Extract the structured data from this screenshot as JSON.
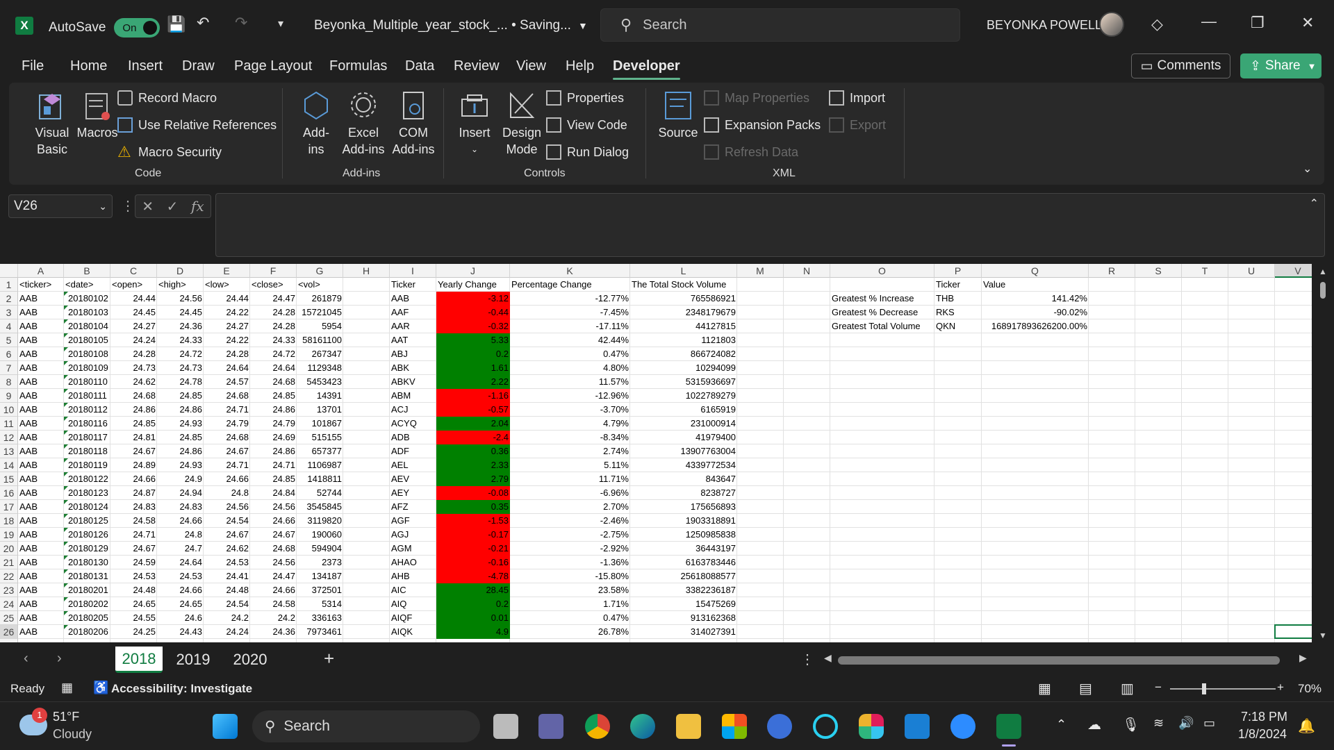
{
  "titlebar": {
    "app_icon": "X",
    "autosave_label": "AutoSave",
    "autosave_state": "On",
    "doc_title": "Beyonka_Multiple_year_stock_...  • Saving...",
    "search_placeholder": "Search",
    "user_name": "BEYONKA POWELL"
  },
  "menu": {
    "items": [
      "File",
      "Home",
      "Insert",
      "Draw",
      "Page Layout",
      "Formulas",
      "Data",
      "Review",
      "View",
      "Help",
      "Developer"
    ],
    "active": "Developer",
    "comments": "Comments",
    "share": "Share"
  },
  "ribbon": {
    "code": {
      "visual_basic": "Visual\nBasic",
      "macros": "Macros",
      "record_macro": "Record Macro",
      "relative_refs": "Use Relative References",
      "macro_security": "Macro Security",
      "label": "Code"
    },
    "addins": {
      "addins": "Add-\nins",
      "excel_addins": "Excel\nAdd-ins",
      "com_addins": "COM\nAdd-ins",
      "label": "Add-ins"
    },
    "controls": {
      "insert": "Insert",
      "design_mode": "Design\nMode",
      "properties": "Properties",
      "view_code": "View Code",
      "run_dialog": "Run Dialog",
      "label": "Controls"
    },
    "xml": {
      "source": "Source",
      "map_properties": "Map Properties",
      "expansion_packs": "Expansion Packs",
      "refresh_data": "Refresh Data",
      "import": "Import",
      "export": "Export",
      "label": "XML"
    }
  },
  "namebox": "V26",
  "columns": [
    "A",
    "B",
    "C",
    "D",
    "E",
    "F",
    "G",
    "H",
    "I",
    "J",
    "K",
    "L",
    "M",
    "N",
    "O",
    "P",
    "Q",
    "R",
    "S",
    "T",
    "U",
    "V"
  ],
  "headers": [
    "<ticker>",
    "<date>",
    "<open>",
    "<high>",
    "<low>",
    "<close>",
    "<vol>",
    "",
    "Ticker",
    "Yearly Change",
    "Percentage Change",
    "The Total Stock Volume"
  ],
  "rows": [
    [
      "AAB",
      "20180102",
      "24.44",
      "24.56",
      "24.44",
      "24.47",
      "261879",
      "AAB",
      "-3.12",
      "-12.77%",
      "765586921"
    ],
    [
      "AAB",
      "20180103",
      "24.45",
      "24.45",
      "24.22",
      "24.28",
      "15721045",
      "AAF",
      "-0.44",
      "-7.45%",
      "2348179679"
    ],
    [
      "AAB",
      "20180104",
      "24.27",
      "24.36",
      "24.27",
      "24.28",
      "5954",
      "AAR",
      "-0.32",
      "-17.11%",
      "44127815"
    ],
    [
      "AAB",
      "20180105",
      "24.24",
      "24.33",
      "24.22",
      "24.33",
      "58161100",
      "AAT",
      "5.33",
      "42.44%",
      "1121803"
    ],
    [
      "AAB",
      "20180108",
      "24.28",
      "24.72",
      "24.28",
      "24.72",
      "267347",
      "ABJ",
      "0.2",
      "0.47%",
      "866724082"
    ],
    [
      "AAB",
      "20180109",
      "24.73",
      "24.73",
      "24.64",
      "24.64",
      "1129348",
      "ABK",
      "1.61",
      "4.80%",
      "10294099"
    ],
    [
      "AAB",
      "20180110",
      "24.62",
      "24.78",
      "24.57",
      "24.68",
      "5453423",
      "ABKV",
      "2.22",
      "11.57%",
      "5315936697"
    ],
    [
      "AAB",
      "20180111",
      "24.68",
      "24.85",
      "24.68",
      "24.85",
      "14391",
      "ABM",
      "-1.16",
      "-12.96%",
      "1022789279"
    ],
    [
      "AAB",
      "20180112",
      "24.86",
      "24.86",
      "24.71",
      "24.86",
      "13701",
      "ACJ",
      "-0.57",
      "-3.70%",
      "6165919"
    ],
    [
      "AAB",
      "20180116",
      "24.85",
      "24.93",
      "24.79",
      "24.79",
      "101867",
      "ACYQ",
      "2.04",
      "4.79%",
      "231000914"
    ],
    [
      "AAB",
      "20180117",
      "24.81",
      "24.85",
      "24.68",
      "24.69",
      "515155",
      "ADB",
      "-2.4",
      "-8.34%",
      "41979400"
    ],
    [
      "AAB",
      "20180118",
      "24.67",
      "24.86",
      "24.67",
      "24.86",
      "657377",
      "ADF",
      "0.36",
      "2.74%",
      "13907763004"
    ],
    [
      "AAB",
      "20180119",
      "24.89",
      "24.93",
      "24.71",
      "24.71",
      "1106987",
      "AEL",
      "2.33",
      "5.11%",
      "4339772534"
    ],
    [
      "AAB",
      "20180122",
      "24.66",
      "24.9",
      "24.66",
      "24.85",
      "1418811",
      "AEV",
      "2.79",
      "11.71%",
      "843647"
    ],
    [
      "AAB",
      "20180123",
      "24.87",
      "24.94",
      "24.8",
      "24.84",
      "52744",
      "AEY",
      "-0.08",
      "-6.96%",
      "8238727"
    ],
    [
      "AAB",
      "20180124",
      "24.83",
      "24.83",
      "24.56",
      "24.56",
      "3545845",
      "AFZ",
      "0.35",
      "2.70%",
      "175656893"
    ],
    [
      "AAB",
      "20180125",
      "24.58",
      "24.66",
      "24.54",
      "24.66",
      "3119820",
      "AGF",
      "-1.53",
      "-2.46%",
      "1903318891"
    ],
    [
      "AAB",
      "20180126",
      "24.71",
      "24.8",
      "24.67",
      "24.67",
      "190060",
      "AGJ",
      "-0.17",
      "-2.75%",
      "1250985838"
    ],
    [
      "AAB",
      "20180129",
      "24.67",
      "24.7",
      "24.62",
      "24.68",
      "594904",
      "AGM",
      "-0.21",
      "-2.92%",
      "36443197"
    ],
    [
      "AAB",
      "20180130",
      "24.59",
      "24.64",
      "24.53",
      "24.56",
      "2373",
      "AHAO",
      "-0.16",
      "-1.36%",
      "6163783446"
    ],
    [
      "AAB",
      "20180131",
      "24.53",
      "24.53",
      "24.41",
      "24.47",
      "134187",
      "AHB",
      "-4.78",
      "-15.80%",
      "25618088577"
    ],
    [
      "AAB",
      "20180201",
      "24.48",
      "24.66",
      "24.48",
      "24.66",
      "372501",
      "AIC",
      "28.45",
      "23.58%",
      "3382236187"
    ],
    [
      "AAB",
      "20180202",
      "24.65",
      "24.65",
      "24.54",
      "24.58",
      "5314",
      "AIQ",
      "0.2",
      "1.71%",
      "15475269"
    ],
    [
      "AAB",
      "20180205",
      "24.55",
      "24.6",
      "24.2",
      "24.2",
      "336163",
      "AIQF",
      "0.01",
      "0.47%",
      "913162368"
    ],
    [
      "AAB",
      "20180206",
      "24.25",
      "24.43",
      "24.24",
      "24.36",
      "7973461",
      "AIQK",
      "4.9",
      "26.78%",
      "314027391"
    ]
  ],
  "summary": {
    "ticker_header": "Ticker",
    "value_header": "Value",
    "items": [
      {
        "label": "Greatest % Increase",
        "ticker": "THB",
        "value": "141.42%"
      },
      {
        "label": "Greatest % Decrease",
        "ticker": "RKS",
        "value": "-90.02%"
      },
      {
        "label": "Greatest Total Volume",
        "ticker": "QKN",
        "value": "168917893626200.00%"
      }
    ]
  },
  "colors": {
    "neg": "#ff0000",
    "pos": "#008000",
    "accent": "#107c41"
  },
  "sheets": [
    "2018",
    "2019",
    "2020"
  ],
  "active_sheet": "2018",
  "status": {
    "ready": "Ready",
    "accessibility": "Accessibility: Investigate",
    "zoom": "70%"
  },
  "taskbar": {
    "weather_temp": "51°F",
    "weather_desc": "Cloudy",
    "weather_badge": "1",
    "search": "Search",
    "time": "7:18 PM",
    "date": "1/8/2024"
  }
}
